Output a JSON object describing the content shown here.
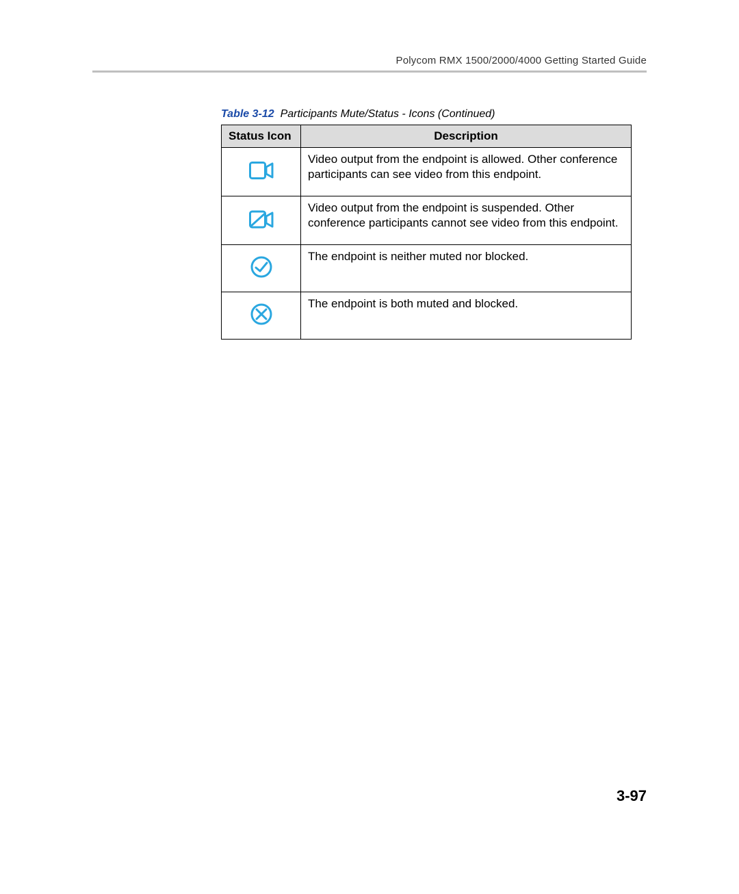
{
  "header": {
    "doc_title": "Polycom RMX 1500/2000/4000 Getting Started Guide"
  },
  "caption": {
    "label": "Table 3-12",
    "title": "Participants Mute/Status - Icons (Continued)"
  },
  "columns": {
    "icon": "Status Icon",
    "desc": "Description"
  },
  "rows": [
    {
      "icon": "video-allowed-icon",
      "desc": "Video output from the endpoint is allowed. Other conference participants can see video from this endpoint."
    },
    {
      "icon": "video-suspended-icon",
      "desc": "Video output from the endpoint is suspended. Other conference participants cannot see video from this endpoint."
    },
    {
      "icon": "not-muted-blocked-icon",
      "desc": "The endpoint is neither muted nor blocked."
    },
    {
      "icon": "muted-blocked-icon",
      "desc": "The endpoint is both muted and blocked."
    }
  ],
  "page_number": "3-97"
}
